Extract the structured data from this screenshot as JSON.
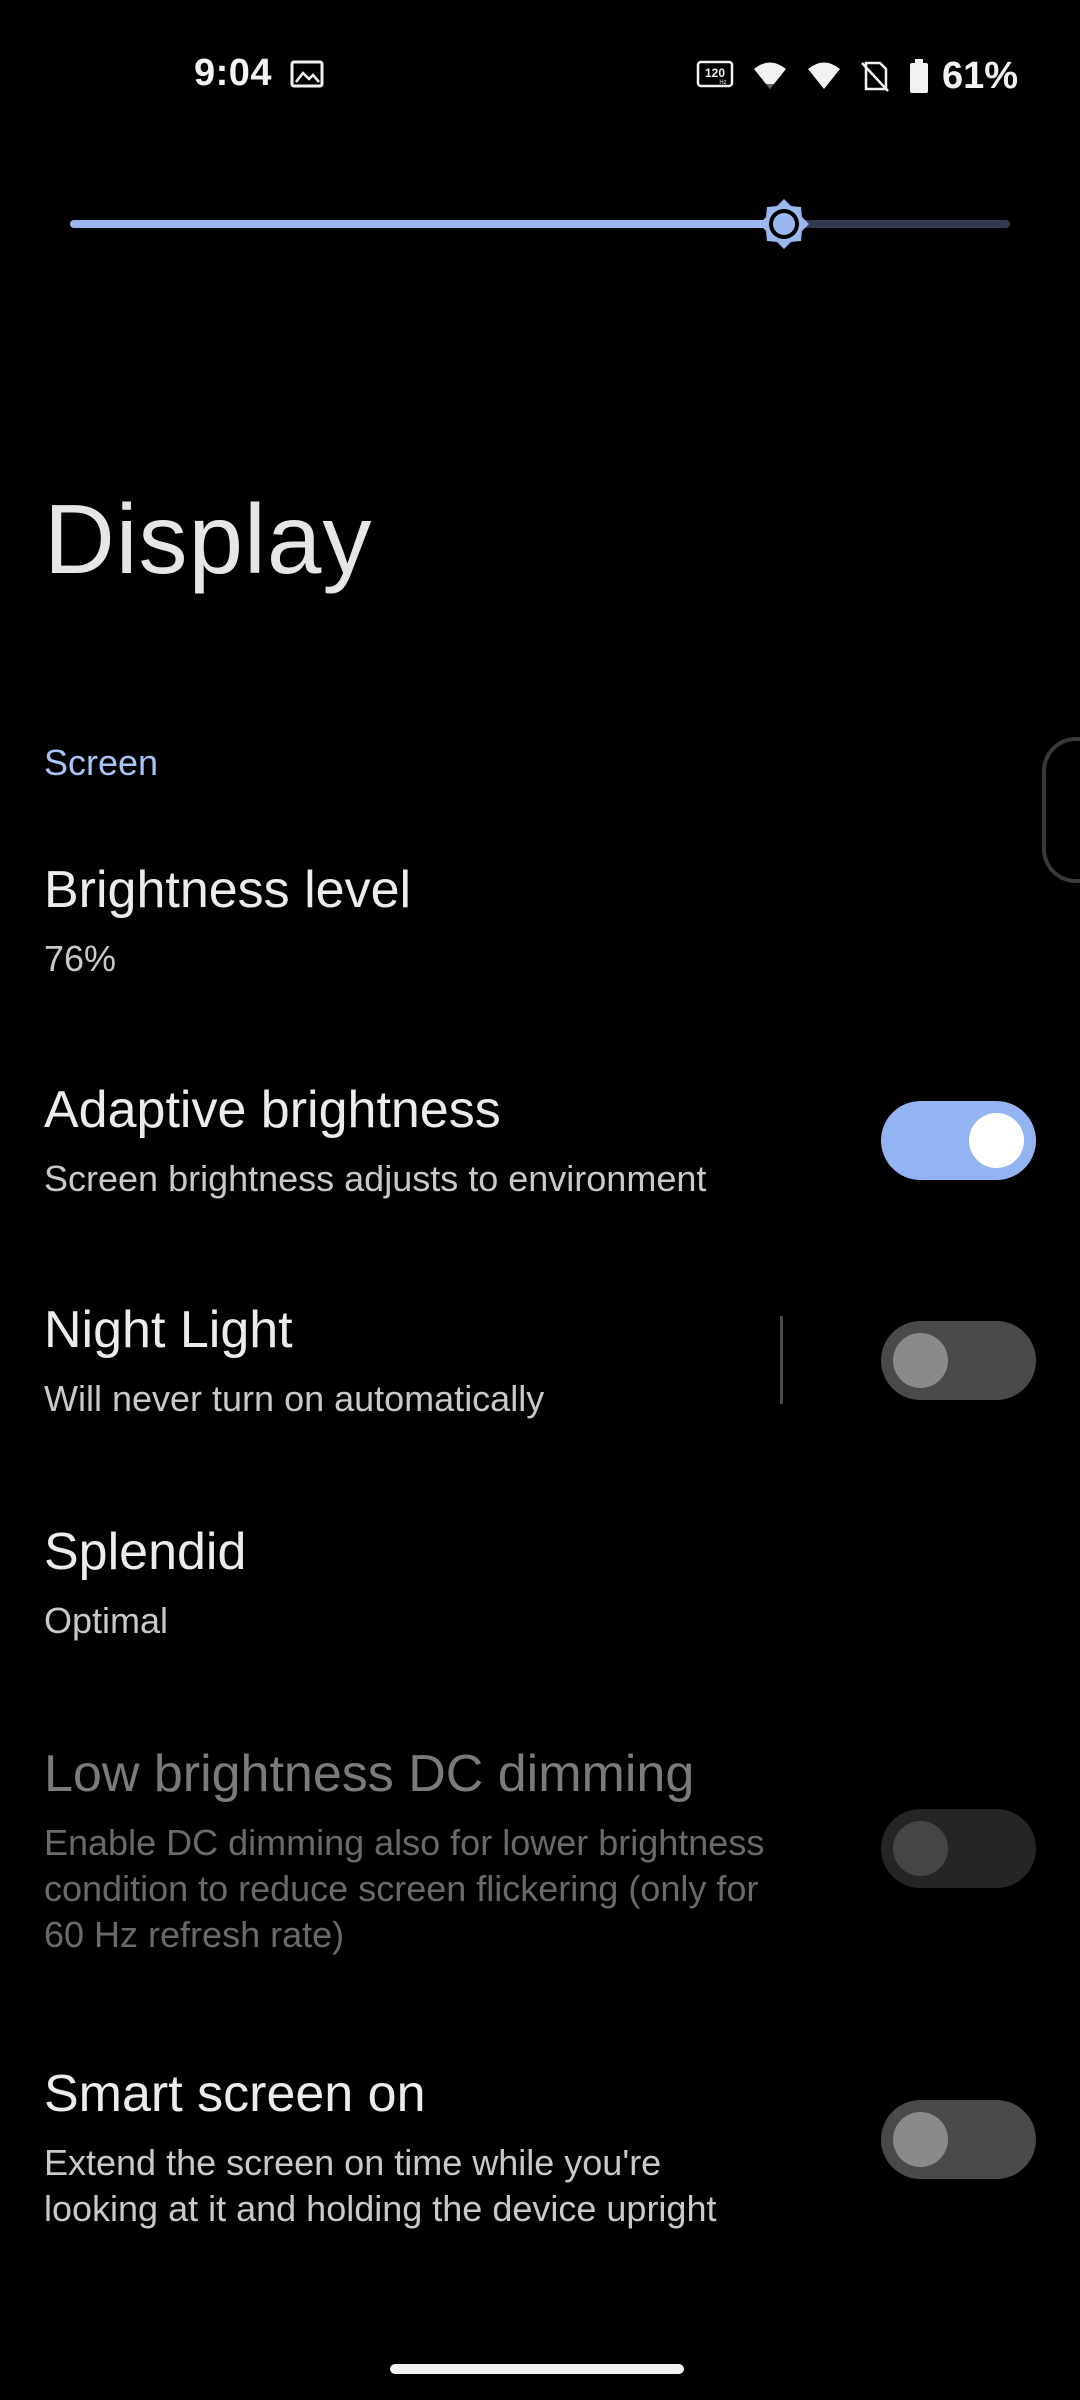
{
  "status_bar": {
    "time": "9:04",
    "battery_percent": "61%",
    "icons": [
      "image-notification-icon",
      "refresh-rate-120hz-icon",
      "wifi-icon",
      "signal-icon",
      "no-sim-icon",
      "battery-icon"
    ],
    "refresh_rate_label": "120",
    "refresh_rate_unit": "Hz"
  },
  "brightness_slider": {
    "level": 0.76,
    "accent_color": "#9cb6ee"
  },
  "page": {
    "title": "Display"
  },
  "section": {
    "header": "Screen"
  },
  "settings": {
    "brightness_level": {
      "title": "Brightness level",
      "summary": "76%"
    },
    "adaptive_brightness": {
      "title": "Adaptive brightness",
      "summary": "Screen brightness adjusts to environment",
      "enabled": true
    },
    "night_light": {
      "title": "Night Light",
      "summary": "Will never turn on automatically",
      "enabled": false
    },
    "splendid": {
      "title": "Splendid",
      "summary": "Optimal"
    },
    "dc_dimming": {
      "title": "Low brightness DC dimming",
      "summary_lines": [
        "Enable DC dimming also for lower brightness",
        "condition to reduce screen flickering (only for",
        "60 Hz refresh rate)"
      ],
      "enabled": false,
      "disabled": true
    },
    "smart_screen_on": {
      "title": "Smart screen on",
      "summary_lines": [
        "Extend the screen on time while you're",
        "looking at it and holding the device upright"
      ],
      "enabled": false
    }
  }
}
